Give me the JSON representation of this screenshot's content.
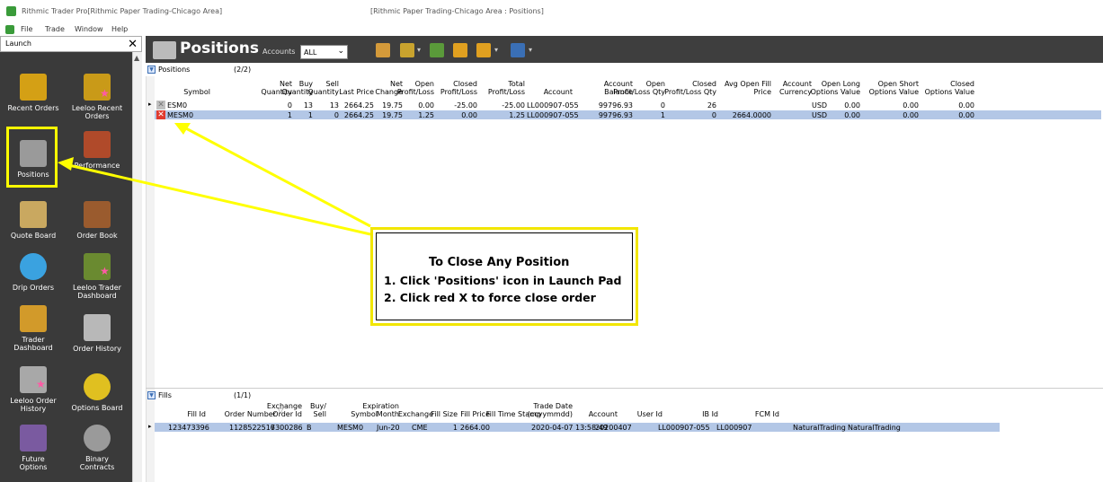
{
  "window": {
    "title": "Rithmic Trader Pro[Rithmic Paper Trading-Chicago Area]",
    "center_title": "[Rithmic Paper Trading-Chicago Area : Positions]"
  },
  "menu": [
    "File",
    "Trade",
    "Window",
    "Help"
  ],
  "launch": {
    "title": "Launch",
    "close": "✕",
    "items": [
      {
        "label1": "Recent Orders",
        "label2": "",
        "icon": "shopping-bag-icon"
      },
      {
        "label1": "Leeloo Recent",
        "label2": "Orders",
        "icon": "shopping-bag-star-icon"
      },
      {
        "label1": "Positions",
        "label2": "",
        "icon": "positions-blocks-icon"
      },
      {
        "label1": "Performance",
        "label2": "",
        "icon": "runner-icon"
      },
      {
        "label1": "Quote Board",
        "label2": "",
        "icon": "scroll-icon"
      },
      {
        "label1": "Order Book",
        "label2": "",
        "icon": "gavel-icon"
      },
      {
        "label1": "Drip Orders",
        "label2": "",
        "icon": "water-drops-icon"
      },
      {
        "label1": "Leeloo Trader",
        "label2": "Dashboard",
        "icon": "money-bag-icon"
      },
      {
        "label1": "Trader",
        "label2": "Dashboard",
        "icon": "treasure-chest-icon"
      },
      {
        "label1": "Order History",
        "label2": "",
        "icon": "file-cabinet-icon"
      },
      {
        "label1": "Leeloo Order",
        "label2": "History",
        "icon": "file-cabinet-star-icon"
      },
      {
        "label1": "Options Board",
        "label2": "",
        "icon": "balloons-icon"
      },
      {
        "label1": "Future",
        "label2": "Options",
        "icon": "stars-icon"
      },
      {
        "label1": "Binary",
        "label2": "Contracts",
        "icon": "coin-icon"
      }
    ]
  },
  "toolbar": {
    "title": "Positions",
    "accounts_label": "Accounts",
    "accounts_value": "ALL"
  },
  "positions": {
    "label": "Positions",
    "count": "(2/2)",
    "headers": [
      [
        "",
        "Symbol"
      ],
      [
        "Net",
        "Quantity"
      ],
      [
        "Buy",
        "Quantity"
      ],
      [
        "Sell",
        "Quantity"
      ],
      [
        "",
        "Last Price"
      ],
      [
        "Net",
        "Change"
      ],
      [
        "Open",
        "Profit/Loss"
      ],
      [
        "Closed",
        "Profit/Loss"
      ],
      [
        "Total",
        "Profit/Loss"
      ],
      [
        "",
        "Account"
      ],
      [
        "Account",
        "Balance"
      ],
      [
        "Open",
        "Profit/Loss Qty"
      ],
      [
        "Closed",
        "Profit/Loss Qty"
      ],
      [
        "Avg Open Fill",
        "Price"
      ],
      [
        "Account",
        "Currency"
      ],
      [
        "Open Long",
        "Options Value"
      ],
      [
        "Open Short",
        "Options Value"
      ],
      [
        "Closed",
        "Options Value"
      ]
    ],
    "rows": [
      [
        "ESM0",
        "0",
        "13",
        "13",
        "2664.25",
        "19.75",
        "0.00",
        "-25.00",
        "-25.00",
        "LL000907-055",
        "99796.93",
        "0",
        "26",
        "",
        "USD",
        "0.00",
        "0.00",
        "0.00"
      ],
      [
        "MESM0",
        "1",
        "1",
        "0",
        "2664.25",
        "19.75",
        "1.25",
        "0.00",
        "1.25",
        "LL000907-055",
        "99796.93",
        "1",
        "0",
        "2664.0000",
        "USD",
        "0.00",
        "0.00",
        "0.00"
      ]
    ],
    "row_marker": "▸"
  },
  "fills": {
    "label": "Fills",
    "count": "(1/1)",
    "headers": [
      [
        "",
        "Fill Id"
      ],
      [
        "",
        "Order Number"
      ],
      [
        "Exchange",
        "Order Id"
      ],
      [
        "Buy/",
        "Sell"
      ],
      [
        "",
        "Symbol"
      ],
      [
        "Expiration",
        "Month"
      ],
      [
        "",
        "Exchange"
      ],
      [
        "",
        "Fill Size"
      ],
      [
        "",
        "Fill Price"
      ],
      [
        "",
        "Fill Time Stamp"
      ],
      [
        "Trade Date",
        "(ccyymmdd)"
      ],
      [
        "",
        "Account"
      ],
      [
        "",
        "User Id"
      ],
      [
        "",
        "IB Id"
      ],
      [
        "",
        "FCM Id"
      ]
    ],
    "sort_marker": "▽",
    "row": [
      "123473396",
      "1128522516",
      "7300286",
      "B",
      "MESM0",
      "Jun-20",
      "CME",
      "1",
      "2664.00",
      "2020-04-07 13:58:49",
      "20200407",
      "LL000907-055",
      "LL000907",
      "NaturalTrading",
      "NaturalTrading"
    ]
  },
  "callout": {
    "title": "To Close Any Position",
    "line1": "1. Click 'Positions' icon in Launch Pad",
    "line2": "2. Click red X to force close order"
  },
  "colors": {
    "highlight": "#ffff00",
    "selected_row": "#b3c7e6",
    "red_x": "#e03a2e",
    "launch_bg": "#3a3a3a"
  }
}
